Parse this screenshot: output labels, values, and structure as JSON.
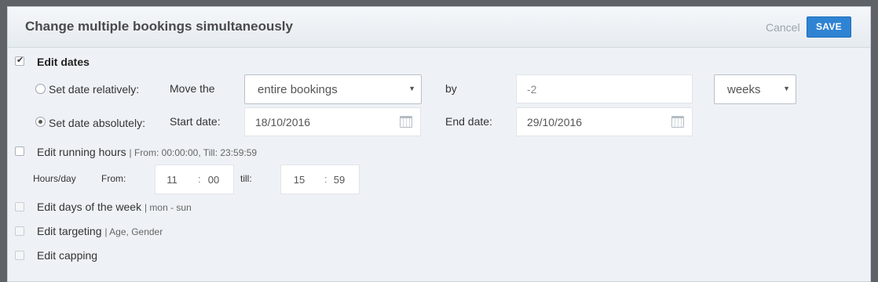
{
  "dialog": {
    "title": "Change multiple bookings simultaneously",
    "cancel_label": "Cancel",
    "save_label": "SAVE"
  },
  "edit_dates": {
    "label": "Edit dates",
    "checked": true,
    "relative": {
      "label": "Set date relatively:",
      "move_label": "Move the",
      "scope_value": "entire bookings",
      "by_label": "by",
      "amount_value": "-2",
      "unit_value": "weeks"
    },
    "absolute": {
      "label": "Set date absolutely:",
      "selected": true,
      "start_label": "Start date:",
      "start_value": "18/10/2016",
      "end_label": "End date:",
      "end_value": "29/10/2016"
    }
  },
  "running_hours": {
    "label": "Edit running hours",
    "hint": "| From: 00:00:00, Till: 23:59:59",
    "hours_label": "Hours/day",
    "from_label": "From:",
    "from_hour": "11",
    "from_minute": "00",
    "till_label": "till:",
    "till_hour": "15",
    "till_minute": "59",
    "separator": ":"
  },
  "days_of_week": {
    "label": "Edit days of the week",
    "hint": "| mon - sun"
  },
  "targeting": {
    "label": "Edit targeting",
    "hint": "| Age, Gender"
  },
  "capping": {
    "label": "Edit capping"
  },
  "icons": {
    "select_caret": "caret-down-icon",
    "date_picker": "calendar-icon",
    "checkmark": "checkmark-icon"
  },
  "colors": {
    "accent": "#2f83d3",
    "dialog_bg": "#eef2f6",
    "backdrop": "#5f6368"
  }
}
